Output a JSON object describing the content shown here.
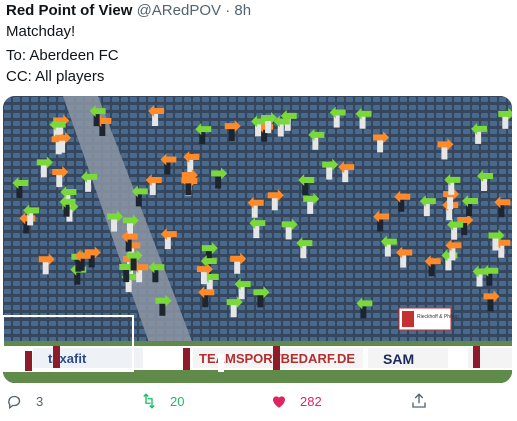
{
  "tweet": {
    "author_name": "Red Point of View",
    "handle": "@ARedPOV",
    "separator": "·",
    "time": "8h",
    "lines": [
      "Matchday!",
      "To: Aberdeen FC",
      "CC: All players"
    ]
  },
  "media": {
    "description": "Crowd in stadium stand holding green and orange arrow signs",
    "banners": {
      "sponsor1": "taxafit",
      "sponsor2": "TEAMSPORTBEDARF.DE",
      "sponsor3": "SAM",
      "sponsor4": "Rieckhoff & Philipp"
    },
    "colors": {
      "seat": "#3a5878",
      "orange": "#ff8a2a",
      "green": "#7ad83a",
      "pitch": "#5f8a4a"
    }
  },
  "actions": {
    "replies": "3",
    "retweets": "20",
    "likes": "282",
    "colors": {
      "reply": "#536471",
      "retweet": "#17bf63",
      "like": "#e0245e"
    }
  }
}
